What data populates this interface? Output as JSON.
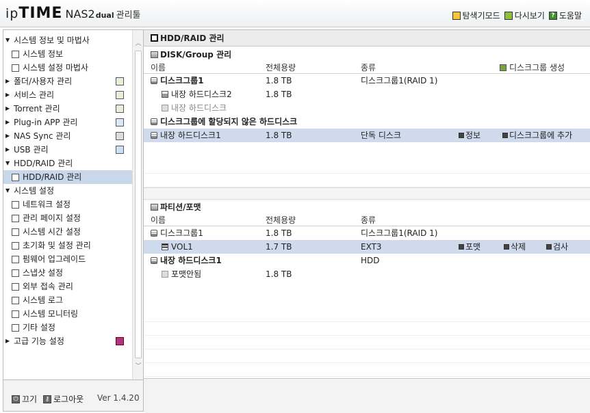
{
  "header": {
    "logo_ip": "ip",
    "logo_time": "TIME",
    "logo_model": "NAS2",
    "logo_dual": "dual",
    "logo_sub": "관리툴",
    "links": [
      {
        "label": "탐색기모드",
        "icon": "folder-icon"
      },
      {
        "label": "다시보기",
        "icon": "refresh-icon"
      },
      {
        "label": "도움말",
        "icon": "help-icon"
      }
    ]
  },
  "sidebar": {
    "items": [
      {
        "label": "시스템 정보 및 마법사",
        "expanded": true
      },
      {
        "label": "시스템 정보"
      },
      {
        "label": "시스템 설정 마법사"
      },
      {
        "label": "폴더/사용자 관리"
      },
      {
        "label": "서비스 관리"
      },
      {
        "label": "Torrent 관리"
      },
      {
        "label": "Plug-in APP 관리"
      },
      {
        "label": "NAS Sync 관리"
      },
      {
        "label": "USB 관리"
      },
      {
        "label": "HDD/RAID 관리",
        "expanded": true
      },
      {
        "label": "HDD/RAID 관리",
        "selected": true
      },
      {
        "label": "시스템 설정",
        "expanded": true
      },
      {
        "label": "네트워크 설정"
      },
      {
        "label": "관리 페이지 설정"
      },
      {
        "label": "시스템 시간 설정"
      },
      {
        "label": "초기화 및 설정 관리"
      },
      {
        "label": "펌웨어 업그레이드"
      },
      {
        "label": "스냅샷 설정"
      },
      {
        "label": "외부 접속 관리"
      },
      {
        "label": "시스템 로그"
      },
      {
        "label": "시스템 모니터링"
      },
      {
        "label": "기타 설정"
      },
      {
        "label": "고급 기능 설정"
      }
    ]
  },
  "footer": {
    "shutdown_label": "끄기",
    "logout_label": "로그아웃",
    "version": "Ver 1.4.20"
  },
  "main": {
    "title": "HDD/RAID 관리",
    "disk_section": {
      "title": "DISK/Group 관리",
      "columns": {
        "name": "이름",
        "capacity": "전체용량",
        "type": "종류"
      },
      "create_group_label": "디스크그룹 생성",
      "group1": {
        "name": "디스크그룹1",
        "capacity": "1.8 TB",
        "type": "디스크그룹1(RAID 1)"
      },
      "disk2": {
        "name": "내장 하드디스크2",
        "capacity": "1.8 TB"
      },
      "disk_missing": {
        "name": "내장 하드디스크"
      },
      "unassigned_title": "디스크그룹에 할당되지 않은 하드디스크",
      "disk1": {
        "name": "내장 하드디스크1",
        "capacity": "1.8 TB",
        "type": "단독 디스크",
        "info_label": "정보",
        "add_label": "디스크그룹에 추가"
      }
    },
    "partition_section": {
      "title": "파티션/포맷",
      "columns": {
        "name": "이름",
        "capacity": "전체용량",
        "type": "종류"
      },
      "group1": {
        "name": "디스크그룹1",
        "capacity": "1.8 TB",
        "type": "디스크그룹1(RAID 1)"
      },
      "vol1": {
        "name": "VOL1",
        "capacity": "1.7 TB",
        "type": "EXT3",
        "format_label": "포맷",
        "delete_label": "삭제",
        "check_label": "검사"
      },
      "disk1": {
        "name": "내장 하드디스크1",
        "type": "HDD"
      },
      "unformatted": {
        "name": "포맷안됨",
        "capacity": "1.8 TB"
      }
    }
  }
}
